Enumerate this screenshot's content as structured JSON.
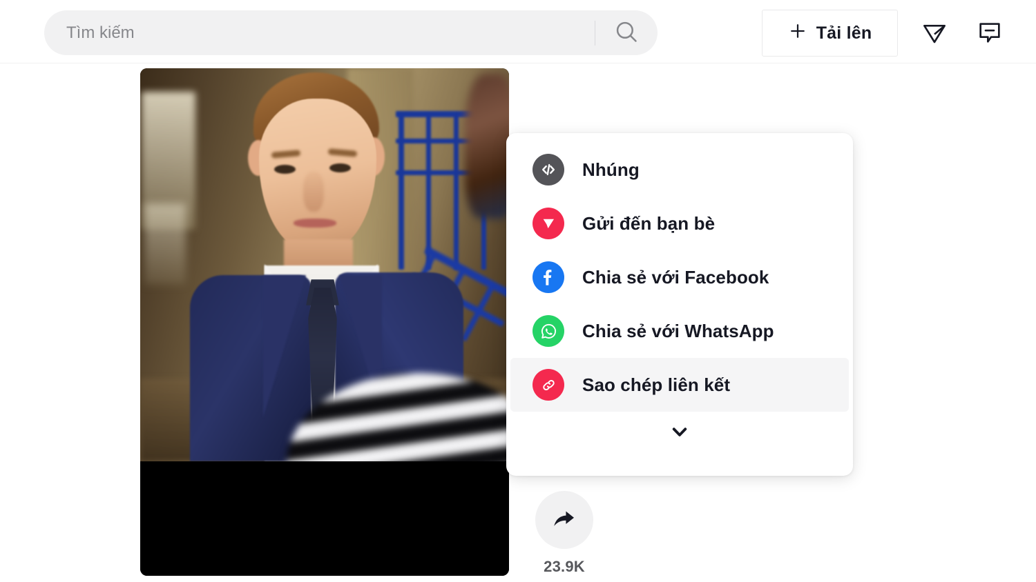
{
  "header": {
    "search": {
      "placeholder": "Tìm kiếm",
      "value": "",
      "search_icon": "search-icon"
    },
    "upload_button": {
      "label": "Tải lên",
      "plus_icon": "plus-icon"
    },
    "icons": [
      {
        "name": "send-message-icon"
      },
      {
        "name": "inbox-message-icon"
      }
    ]
  },
  "video": {
    "alt": "Man in navy blue suit with white shirt and dark tie standing in a corridor with blue railings"
  },
  "share_menu": {
    "items": [
      {
        "label": "Nhúng",
        "icon": "embed-code-icon",
        "icon_color": "#545458",
        "active": false
      },
      {
        "label": "Gửi đến bạn bè",
        "icon": "send-plane-icon",
        "icon_color": "#f4294e",
        "active": false
      },
      {
        "label": "Chia sẻ với Facebook",
        "icon": "facebook-icon",
        "icon_color": "#1877f2",
        "active": false
      },
      {
        "label": "Chia sẻ với WhatsApp",
        "icon": "whatsapp-icon",
        "icon_color": "#25d366",
        "active": false
      },
      {
        "label": "Sao chép liên kết",
        "icon": "copy-link-icon",
        "icon_color": "#f4294e",
        "active": true
      }
    ],
    "expand_icon": "chevron-down-icon"
  },
  "share_button": {
    "icon": "share-arrow-icon",
    "count": "23.9K"
  },
  "colors": {
    "accent_red": "#f4294e",
    "facebook_blue": "#1877f2",
    "whatsapp_green": "#25d366",
    "embed_gray": "#545458",
    "text_primary": "#161823",
    "surface_gray": "#f1f1f2"
  }
}
